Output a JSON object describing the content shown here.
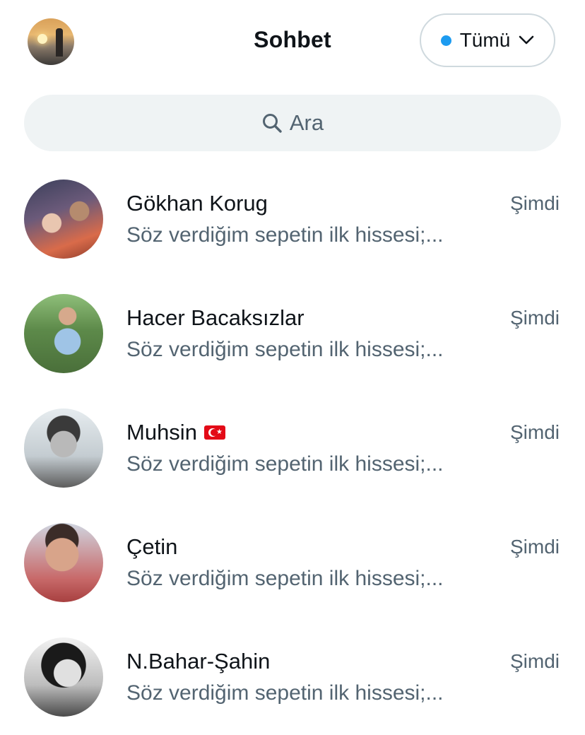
{
  "header": {
    "title": "Sohbet",
    "filter_label": "Tümü",
    "accent": "#1d9bf0"
  },
  "search": {
    "placeholder": "Ara"
  },
  "conversations": [
    {
      "name": "Gökhan Korug",
      "preview": "Söz verdiğim sepetin ilk hissesi;...",
      "time": "Şimdi"
    },
    {
      "name": "Hacer Bacaksızlar",
      "preview": "Söz verdiğim sepetin ilk hissesi;...",
      "time": "Şimdi"
    },
    {
      "name": "Muhsin",
      "flag_icon": "turkey-flag-icon",
      "preview": "Söz verdiğim sepetin ilk hissesi;...",
      "time": "Şimdi"
    },
    {
      "name": "Çetin",
      "preview": "Söz verdiğim sepetin ilk hissesi;...",
      "time": "Şimdi"
    },
    {
      "name": "N.Bahar-Şahin",
      "preview": "Söz verdiğim sepetin ilk hissesi;...",
      "time": "Şimdi"
    }
  ],
  "colors": {
    "primary_text": "#0f1419",
    "secondary_text": "#536471",
    "search_bg": "#eff3f4",
    "border": "#cfd9de"
  }
}
